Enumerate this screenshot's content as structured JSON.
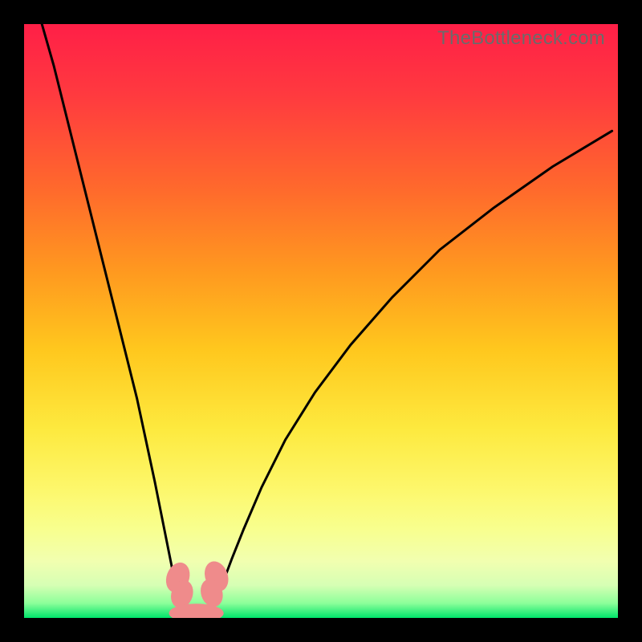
{
  "watermark": "TheBottleneck.com",
  "colors": {
    "frame": "#000000",
    "curve": "#000000",
    "marker_fill": "#ef8b8b",
    "marker_stroke": "#b85b5b",
    "gradient_stops": [
      {
        "offset": 0.0,
        "color": "#ff1f47"
      },
      {
        "offset": 0.12,
        "color": "#ff3a3f"
      },
      {
        "offset": 0.28,
        "color": "#ff6a2c"
      },
      {
        "offset": 0.42,
        "color": "#ff9a1f"
      },
      {
        "offset": 0.55,
        "color": "#ffc81e"
      },
      {
        "offset": 0.68,
        "color": "#fde93e"
      },
      {
        "offset": 0.78,
        "color": "#fdf76a"
      },
      {
        "offset": 0.85,
        "color": "#f8ff8e"
      },
      {
        "offset": 0.905,
        "color": "#f1ffb0"
      },
      {
        "offset": 0.945,
        "color": "#d6ffb4"
      },
      {
        "offset": 0.975,
        "color": "#8dff9a"
      },
      {
        "offset": 1.0,
        "color": "#00e46a"
      }
    ]
  },
  "chart_data": {
    "type": "line",
    "title": "",
    "xlabel": "",
    "ylabel": "",
    "xlim": [
      0,
      100
    ],
    "ylim": [
      0,
      100
    ],
    "grid": false,
    "series": [
      {
        "name": "left-branch",
        "x": [
          3,
          5,
          7,
          9,
          11,
          13,
          15,
          17,
          19,
          20.5,
          22,
          23.2,
          24.2,
          25.0,
          25.8,
          26.4
        ],
        "y": [
          100,
          93,
          85,
          77,
          69,
          61,
          53,
          45,
          37,
          30,
          23,
          17,
          12,
          8,
          5,
          3
        ]
      },
      {
        "name": "valley",
        "x": [
          26.4,
          27.2,
          28.2,
          29.2,
          30.2,
          31.2,
          32.2
        ],
        "y": [
          3,
          1.3,
          0.6,
          0.5,
          0.6,
          1.2,
          3
        ]
      },
      {
        "name": "right-branch",
        "x": [
          32.2,
          33.5,
          35,
          37,
          40,
          44,
          49,
          55,
          62,
          70,
          79,
          89,
          99
        ],
        "y": [
          3,
          6,
          10,
          15,
          22,
          30,
          38,
          46,
          54,
          62,
          69,
          76,
          82
        ]
      }
    ],
    "markers": [
      {
        "name": "left-top",
        "x": 25.9,
        "y": 6.8,
        "rx": 1.9,
        "ry": 2.6,
        "rot": 20
      },
      {
        "name": "left-bot",
        "x": 26.6,
        "y": 4.0,
        "rx": 1.8,
        "ry": 2.4,
        "rot": 18
      },
      {
        "name": "right-top",
        "x": 32.4,
        "y": 7.0,
        "rx": 1.9,
        "ry": 2.6,
        "rot": -20
      },
      {
        "name": "right-bot",
        "x": 31.6,
        "y": 4.2,
        "rx": 1.8,
        "ry": 2.4,
        "rot": -18
      },
      {
        "name": "bottom-wide",
        "x": 29.0,
        "y": 0.8,
        "rx": 4.6,
        "ry": 1.6,
        "rot": 0
      }
    ]
  }
}
